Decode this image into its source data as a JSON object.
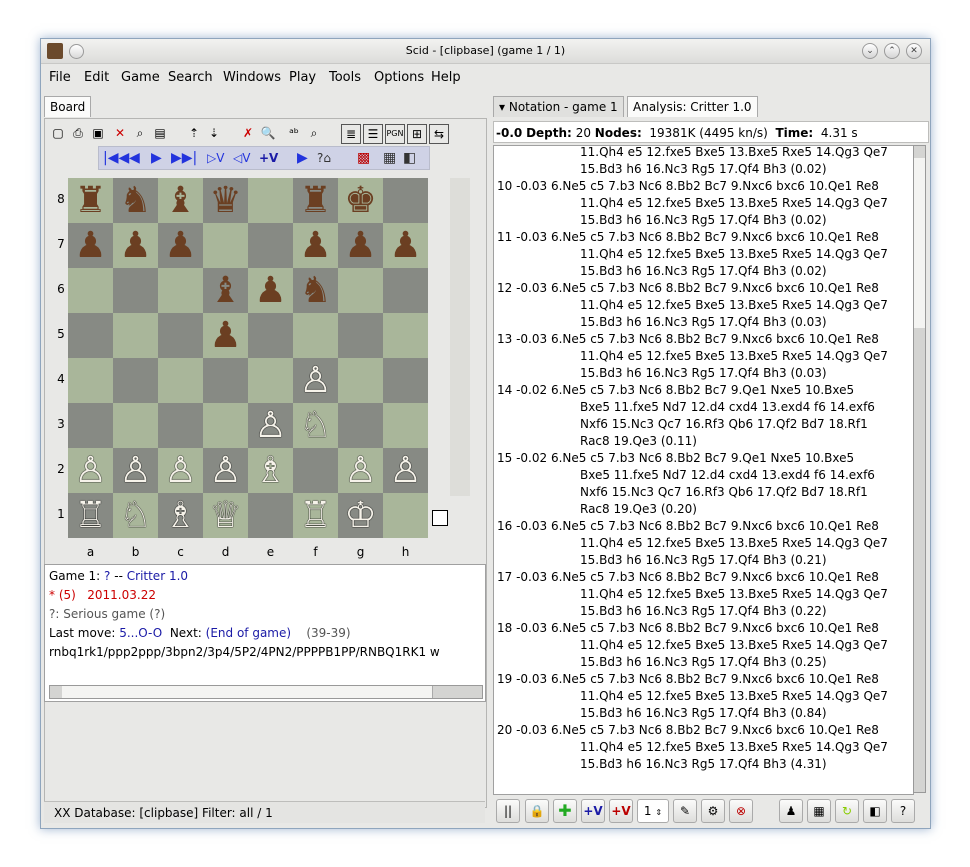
{
  "window": {
    "title": "Scid - [clipbase] (game 1 / 1)"
  },
  "menu": [
    "File",
    "Edit",
    "Game",
    "Search",
    "Windows",
    "Play",
    "Tools",
    "Options",
    "Help"
  ],
  "tabs": {
    "board": "Board",
    "notation": "Notation - game 1",
    "analysis": "Analysis: Critter 1.0"
  },
  "toolbar": {
    "icons": [
      "new-game-icon",
      "open-icon",
      "save-icon",
      "close-icon",
      "find-icon",
      "export-icon",
      "move-up-icon",
      "move-down-icon",
      "delete-icon",
      "search-icon",
      "rename-icon",
      "zoom-icon",
      "list-icon",
      "grid-icon",
      "pgn-label",
      "tree-icon",
      "switch-icon"
    ],
    "pgn_label": "PGN",
    "delete_label": "✕"
  },
  "navbar": {
    "first": "|◀◀",
    "back": "◀",
    "forward": "▶",
    "last": "▶▶|",
    "enter_var": "▷V",
    "exit_var": "◁V",
    "add_var": "+V"
  },
  "board": {
    "ranks": [
      "8",
      "7",
      "6",
      "5",
      "4",
      "3",
      "2",
      "1"
    ],
    "files": [
      "a",
      "b",
      "c",
      "d",
      "e",
      "f",
      "g",
      "h"
    ],
    "pieces": [
      [
        {
          "g": "♜",
          "c": "b"
        },
        {
          "g": "♞",
          "c": "b"
        },
        {
          "g": "♝",
          "c": "b"
        },
        {
          "g": "♛",
          "c": "b"
        },
        null,
        {
          "g": "♜",
          "c": "b"
        },
        {
          "g": "♚",
          "c": "b"
        },
        null
      ],
      [
        {
          "g": "♟",
          "c": "b"
        },
        {
          "g": "♟",
          "c": "b"
        },
        {
          "g": "♟",
          "c": "b"
        },
        null,
        null,
        {
          "g": "♟",
          "c": "b"
        },
        {
          "g": "♟",
          "c": "b"
        },
        {
          "g": "♟",
          "c": "b"
        }
      ],
      [
        null,
        null,
        null,
        {
          "g": "♝",
          "c": "b"
        },
        {
          "g": "♟",
          "c": "b"
        },
        {
          "g": "♞",
          "c": "b"
        },
        null,
        null
      ],
      [
        null,
        null,
        null,
        {
          "g": "♟",
          "c": "b"
        },
        null,
        null,
        null,
        null
      ],
      [
        null,
        null,
        null,
        null,
        null,
        {
          "g": "♙",
          "c": "w"
        },
        null,
        null
      ],
      [
        null,
        null,
        null,
        null,
        {
          "g": "♙",
          "c": "w"
        },
        {
          "g": "♘",
          "c": "w"
        },
        null,
        null
      ],
      [
        {
          "g": "♙",
          "c": "w"
        },
        {
          "g": "♙",
          "c": "w"
        },
        {
          "g": "♙",
          "c": "w"
        },
        {
          "g": "♙",
          "c": "w"
        },
        {
          "g": "♗",
          "c": "w"
        },
        null,
        {
          "g": "♙",
          "c": "w"
        },
        {
          "g": "♙",
          "c": "w"
        }
      ],
      [
        {
          "g": "♖",
          "c": "w"
        },
        {
          "g": "♘",
          "c": "w"
        },
        {
          "g": "♗",
          "c": "w"
        },
        {
          "g": "♕",
          "c": "w"
        },
        null,
        {
          "g": "♖",
          "c": "w"
        },
        {
          "g": "♔",
          "c": "w"
        },
        null
      ]
    ]
  },
  "game_info": {
    "game_label": "Game 1:",
    "white": "?",
    "sep": "--",
    "black": "Critter 1.0",
    "result": "* (5)",
    "date": "2011.03.22",
    "event": "?:",
    "event_desc": "Serious game (?)",
    "last_move_label": "Last move:",
    "last_move": "5...O-O",
    "next_label": "Next:",
    "next": "(End of game)",
    "ply": "(39-39)",
    "fen": "rnbq1rk1/ppp2ppp/3bpn2/3p4/5P2/4PN2/PPPPB1PP/RNBQ1RK1 w"
  },
  "status": {
    "text": "XX  Database: [clipbase]   Filter: all / 1"
  },
  "analysis": {
    "score": "-0.0",
    "depth_label": "Depth:",
    "depth": "20",
    "nodes_label": "Nodes:",
    "nodes": "19381K (4495 kn/s)",
    "time_label": "Time:",
    "time": "4.31 s",
    "lines": [
      "                    11.Qh4 e5 12.fxe5 Bxe5 13.Bxe5 Rxe5 14.Qg3 Qe7",
      "                    15.Bd3 h6 16.Nc3 Rg5 17.Qf4 Bh3  (0.02)",
      "10 -0.03 6.Ne5 c5 7.b3 Nc6 8.Bb2 Bc7 9.Nxc6 bxc6 10.Qe1 Re8",
      "                    11.Qh4 e5 12.fxe5 Bxe5 13.Bxe5 Rxe5 14.Qg3 Qe7",
      "                    15.Bd3 h6 16.Nc3 Rg5 17.Qf4 Bh3  (0.02)",
      "11 -0.03 6.Ne5 c5 7.b3 Nc6 8.Bb2 Bc7 9.Nxc6 bxc6 10.Qe1 Re8",
      "                    11.Qh4 e5 12.fxe5 Bxe5 13.Bxe5 Rxe5 14.Qg3 Qe7",
      "                    15.Bd3 h6 16.Nc3 Rg5 17.Qf4 Bh3  (0.02)",
      "12 -0.03 6.Ne5 c5 7.b3 Nc6 8.Bb2 Bc7 9.Nxc6 bxc6 10.Qe1 Re8",
      "                    11.Qh4 e5 12.fxe5 Bxe5 13.Bxe5 Rxe5 14.Qg3 Qe7",
      "                    15.Bd3 h6 16.Nc3 Rg5 17.Qf4 Bh3  (0.03)",
      "13 -0.03 6.Ne5 c5 7.b3 Nc6 8.Bb2 Bc7 9.Nxc6 bxc6 10.Qe1 Re8",
      "                    11.Qh4 e5 12.fxe5 Bxe5 13.Bxe5 Rxe5 14.Qg3 Qe7",
      "                    15.Bd3 h6 16.Nc3 Rg5 17.Qf4 Bh3  (0.03)",
      "14 -0.02 6.Ne5 c5 7.b3 Nc6 8.Bb2 Bc7 9.Qe1 Nxe5 10.Bxe5",
      "                    Bxe5 11.fxe5 Nd7 12.d4 cxd4 13.exd4 f6 14.exf6",
      "                    Nxf6 15.Nc3 Qc7 16.Rf3 Qb6 17.Qf2 Bd7 18.Rf1",
      "                    Rac8 19.Qe3  (0.11)",
      "15 -0.02 6.Ne5 c5 7.b3 Nc6 8.Bb2 Bc7 9.Qe1 Nxe5 10.Bxe5",
      "                    Bxe5 11.fxe5 Nd7 12.d4 cxd4 13.exd4 f6 14.exf6",
      "                    Nxf6 15.Nc3 Qc7 16.Rf3 Qb6 17.Qf2 Bd7 18.Rf1",
      "                    Rac8 19.Qe3  (0.20)",
      "16 -0.03 6.Ne5 c5 7.b3 Nc6 8.Bb2 Bc7 9.Nxc6 bxc6 10.Qe1 Re8",
      "                    11.Qh4 e5 12.fxe5 Bxe5 13.Bxe5 Rxe5 14.Qg3 Qe7",
      "                    15.Bd3 h6 16.Nc3 Rg5 17.Qf4 Bh3  (0.21)",
      "17 -0.03 6.Ne5 c5 7.b3 Nc6 8.Bb2 Bc7 9.Nxc6 bxc6 10.Qe1 Re8",
      "                    11.Qh4 e5 12.fxe5 Bxe5 13.Bxe5 Rxe5 14.Qg3 Qe7",
      "                    15.Bd3 h6 16.Nc3 Rg5 17.Qf4 Bh3  (0.22)",
      "18 -0.03 6.Ne5 c5 7.b3 Nc6 8.Bb2 Bc7 9.Nxc6 bxc6 10.Qe1 Re8",
      "                    11.Qh4 e5 12.fxe5 Bxe5 13.Bxe5 Rxe5 14.Qg3 Qe7",
      "                    15.Bd3 h6 16.Nc3 Rg5 17.Qf4 Bh3  (0.25)",
      "19 -0.03 6.Ne5 c5 7.b3 Nc6 8.Bb2 Bc7 9.Nxc6 bxc6 10.Qe1 Re8",
      "                    11.Qh4 e5 12.fxe5 Bxe5 13.Bxe5 Rxe5 14.Qg3 Qe7",
      "                    15.Bd3 h6 16.Nc3 Rg5 17.Qf4 Bh3  (0.84)",
      "20 -0.03 6.Ne5 c5 7.b3 Nc6 8.Bb2 Bc7 9.Nxc6 bxc6 10.Qe1 Re8",
      "                    11.Qh4 e5 12.fxe5 Bxe5 13.Bxe5 Rxe5 14.Qg3 Qe7",
      "                    15.Bd3 h6 16.Nc3 Rg5 17.Qf4 Bh3  (4.31)"
    ],
    "toolbar": {
      "pause": "||",
      "add_var": "+V",
      "add_all_var": "+V",
      "multipv": "1",
      "help": "?"
    }
  },
  "colors": {
    "link_blue": "#1a1aa6",
    "result_red": "#cc0000",
    "nav_blue": "#2233dd"
  }
}
